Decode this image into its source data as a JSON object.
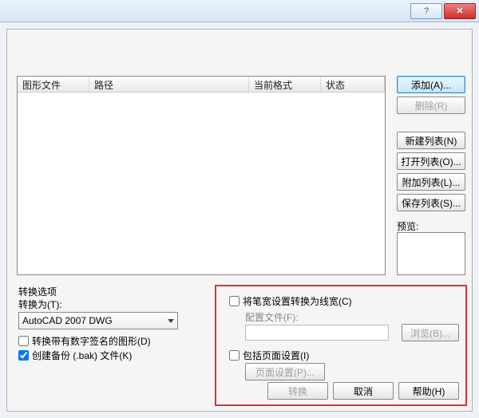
{
  "titlebar": {
    "help": "?",
    "close": "✕"
  },
  "columns": {
    "file": "图形文件",
    "path": "路径",
    "format": "当前格式",
    "status": "状态"
  },
  "buttons": {
    "add": "添加(A)...",
    "remove": "删除(R)",
    "newlist": "新建列表(N)",
    "openlist": "打开列表(O)...",
    "appendlist": "附加列表(L)...",
    "savelist": "保存列表(S)...",
    "browse": "浏览(B)...",
    "pagesetup": "页面设置(P)...",
    "convert": "转换",
    "cancel": "取消",
    "helpbtn": "帮助(H)"
  },
  "labels": {
    "preview": "预览:",
    "options": "转换选项",
    "convertto": "转换为(T):",
    "combo": "AutoCAD 2007 DWG",
    "chk_sig": "转换带有数字签名的图形(D)",
    "chk_bak": "创建备份 (.bak) 文件(K)",
    "chk_pen": "将笔宽设置转换为线宽(C)",
    "cfgfile": "配置文件(F):",
    "chk_page": "包括页面设置(I)"
  },
  "state": {
    "bak_checked": true
  }
}
